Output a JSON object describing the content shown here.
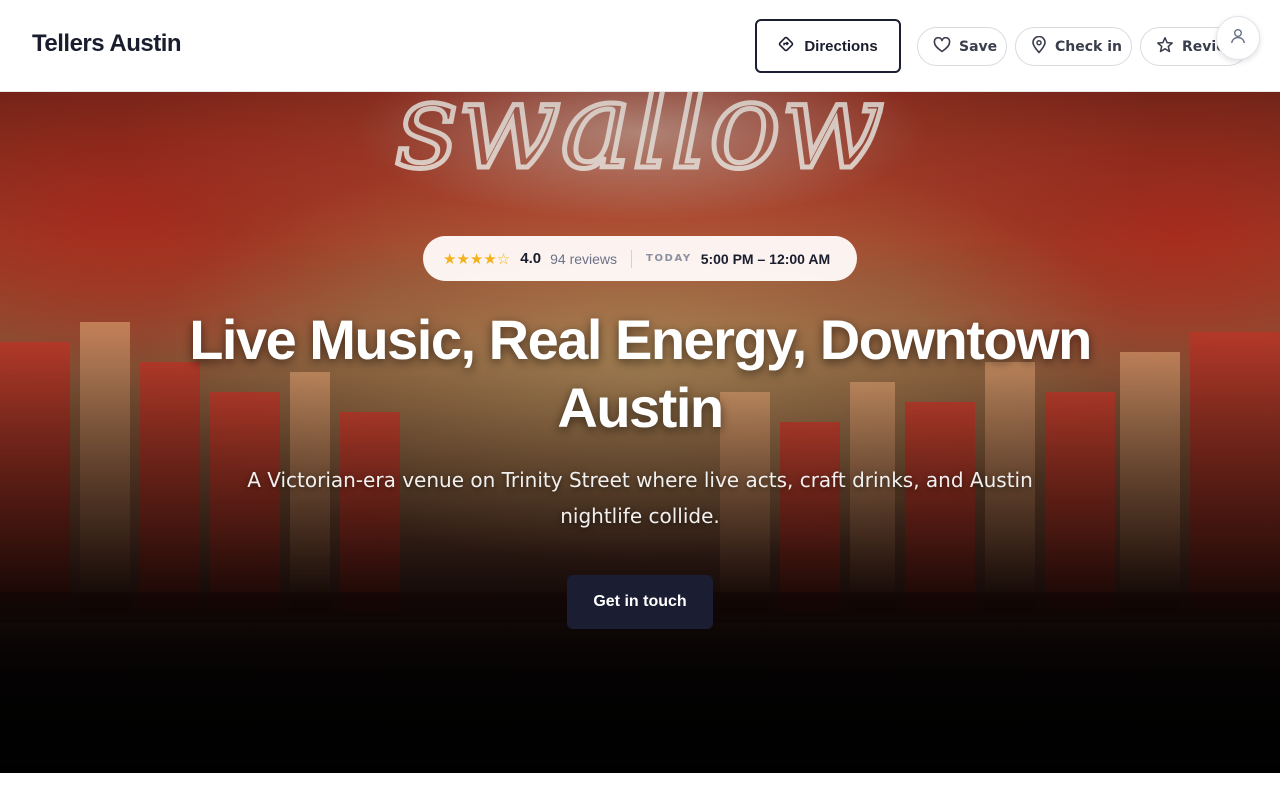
{
  "header": {
    "brand": "Tellers Austin",
    "directions_label": "Directions",
    "save_label": "Save",
    "checkin_label": "Check in",
    "review_label": "Review"
  },
  "hero": {
    "neon_text": "swallow",
    "stars": "★★★★☆",
    "rating": "4.0",
    "reviews": "94 reviews",
    "today_label": "TODAY",
    "hours": "5:00 PM – 12:00 AM",
    "headline": "Live Music, Real Energy, Downtown Austin",
    "subhead": "A Victorian-era venue on Trinity Street where live acts, craft drinks, and Austin nightlife collide.",
    "cta_label": "Get in touch"
  },
  "icons": {
    "directions": "directions-icon",
    "save": "heart-icon",
    "checkin": "map-pin-icon",
    "review": "star-icon",
    "avatar": "user-icon"
  },
  "colors": {
    "brand_dark": "#1b1e33",
    "star": "#f3b21a",
    "muted": "#6b7288"
  }
}
